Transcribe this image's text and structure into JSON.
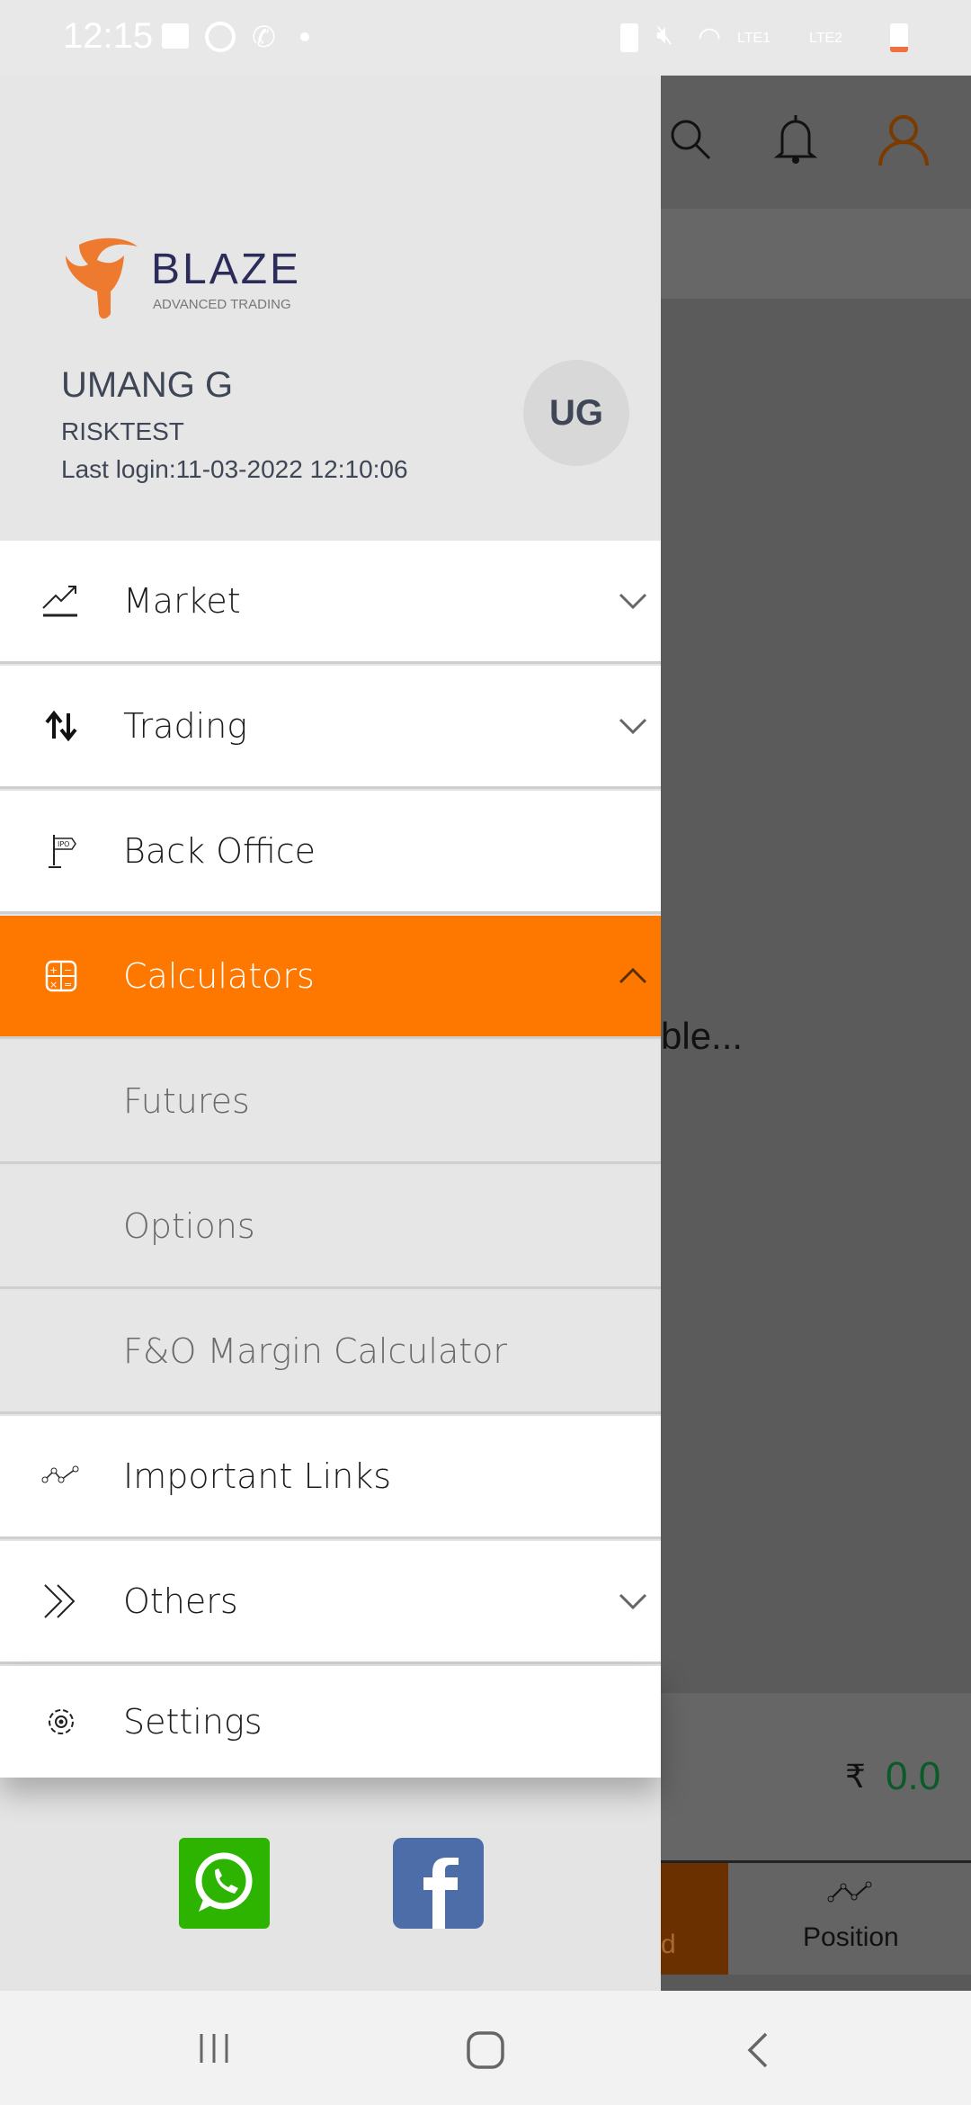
{
  "status_bar": {
    "time": "12:15",
    "sim1": "LTE1",
    "sim2": "LTE2"
  },
  "app_behind": {
    "loading_text": "ble...",
    "currency_symbol": "₹",
    "amount": "0.0",
    "amount_color": "#0a5a2a",
    "tab_partial": "d",
    "tab_position": "Position"
  },
  "drawer": {
    "logo": {
      "brand": "BLAZE",
      "tagline": "ADVANCED TRADING"
    },
    "user": {
      "name": "UMANG G",
      "id": "RISKTEST",
      "last_login": "Last login:11-03-2022 12:10:06",
      "initials": "UG"
    },
    "accent": "#fe7800",
    "items": [
      {
        "label": "Market",
        "icon": "trending-up-icon",
        "expandable": true
      },
      {
        "label": "Trading",
        "icon": "trade-arrows-icon",
        "expandable": true
      },
      {
        "label": "Back Office",
        "icon": "ipo-flag-icon",
        "expandable": false
      },
      {
        "label": "Calculators",
        "icon": "calculator-icon",
        "expandable": true,
        "expanded": true,
        "active": true
      },
      {
        "label": "Futures",
        "sub": true
      },
      {
        "label": "Options",
        "sub": true
      },
      {
        "label": "F&O Margin Calculator",
        "sub": true
      },
      {
        "label": "Important Links",
        "icon": "nodes-icon",
        "expandable": false
      },
      {
        "label": "Others",
        "icon": "double-chevron-icon",
        "expandable": true
      },
      {
        "label": "Settings",
        "icon": "gear-icon",
        "expandable": false
      }
    ],
    "social": [
      "whatsapp-icon",
      "facebook-icon"
    ]
  }
}
